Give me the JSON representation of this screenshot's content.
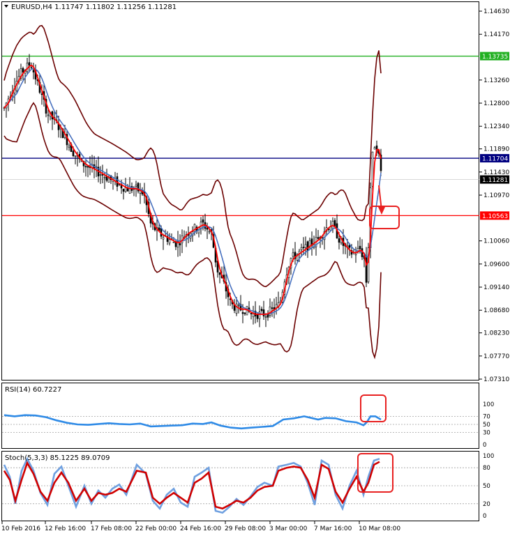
{
  "chart_data": [
    {
      "type": "candlestick",
      "title": "EURUSD,H4  1.11747 1.11802 1.11256 1.11281",
      "ylim": [
        1.0731,
        1.1463
      ],
      "yticks": [
        "1.14630",
        "1.14170",
        "1.13260",
        "1.12800",
        "1.12340",
        "1.11890",
        "1.11430",
        "1.10970",
        "1.10060",
        "1.09600",
        "1.09140",
        "1.08680",
        "1.08230",
        "1.07770",
        "1.07310"
      ],
      "x_tick_labels": [
        "10 Feb 2016",
        "12 Feb 16:00",
        "17 Feb 08:00",
        "22 Feb 00:00",
        "24 Feb 16:00",
        "29 Feb 08:00",
        "3 Mar 00:00",
        "7 Mar 16:00",
        "10 Mar 08:00"
      ],
      "horizontal_levels": [
        {
          "value": 1.13735,
          "label": "1.13735",
          "color": "#22b022"
        },
        {
          "value": 1.11704,
          "label": "1.11704",
          "color": "#000080"
        },
        {
          "value": 1.10563,
          "label": "1.10563",
          "color": "#ff0000"
        }
      ],
      "current_price": {
        "value": 1.11281,
        "label": "1.11281"
      },
      "price_path": [
        [
          0,
          1.127
        ],
        [
          12,
          1.131
        ],
        [
          24,
          1.134
        ],
        [
          38,
          1.136
        ],
        [
          50,
          1.131
        ],
        [
          62,
          1.126
        ],
        [
          75,
          1.124
        ],
        [
          88,
          1.121
        ],
        [
          100,
          1.118
        ],
        [
          112,
          1.116
        ],
        [
          125,
          1.115
        ],
        [
          138,
          1.114
        ],
        [
          150,
          1.113
        ],
        [
          162,
          1.112
        ],
        [
          175,
          1.111
        ],
        [
          188,
          1.111
        ],
        [
          200,
          1.11
        ],
        [
          210,
          1.104
        ],
        [
          222,
          1.102
        ],
        [
          235,
          1.101
        ],
        [
          248,
          1.1
        ],
        [
          260,
          1.102
        ],
        [
          272,
          1.103
        ],
        [
          285,
          1.104
        ],
        [
          297,
          1.102
        ],
        [
          305,
          1.095
        ],
        [
          315,
          1.092
        ],
        [
          325,
          1.088
        ],
        [
          335,
          1.087
        ],
        [
          345,
          1.087
        ],
        [
          355,
          1.086
        ],
        [
          365,
          1.086
        ],
        [
          375,
          1.086
        ],
        [
          385,
          1.087
        ],
        [
          395,
          1.088
        ],
        [
          402,
          1.093
        ],
        [
          410,
          1.097
        ],
        [
          420,
          1.098
        ],
        [
          430,
          1.099
        ],
        [
          440,
          1.1
        ],
        [
          450,
          1.101
        ],
        [
          460,
          1.103
        ],
        [
          470,
          1.104
        ],
        [
          480,
          1.101
        ],
        [
          490,
          1.099
        ],
        [
          500,
          1.098
        ],
        [
          510,
          1.099
        ],
        [
          516,
          1.097
        ],
        [
          520,
          1.091
        ],
        [
          523,
          1.104
        ],
        [
          526,
          1.115
        ],
        [
          530,
          1.12
        ],
        [
          534,
          1.119
        ],
        [
          538,
          1.117
        ],
        [
          541,
          1.113
        ]
      ],
      "ma_red_color": "#ff0000",
      "ma_blue_color": "#4472c4",
      "band_color": "#6b0000"
    },
    {
      "type": "line",
      "title": "RSI(14) 60.7227",
      "ylim": [
        0,
        100
      ],
      "yticks": [
        "100",
        "70",
        "50",
        "30",
        "0"
      ],
      "series": [
        {
          "values": [
            [
              0,
              73
            ],
            [
              15,
              70
            ],
            [
              30,
              73
            ],
            [
              45,
              72
            ],
            [
              60,
              68
            ],
            [
              75,
              60
            ],
            [
              90,
              54
            ],
            [
              105,
              50
            ],
            [
              120,
              49
            ],
            [
              135,
              51
            ],
            [
              150,
              53
            ],
            [
              165,
              51
            ],
            [
              180,
              50
            ],
            [
              195,
              52
            ],
            [
              210,
              45
            ],
            [
              225,
              46
            ],
            [
              240,
              47
            ],
            [
              255,
              48
            ],
            [
              270,
              52
            ],
            [
              285,
              51
            ],
            [
              297,
              55
            ],
            [
              310,
              47
            ],
            [
              325,
              42
            ],
            [
              340,
              40
            ],
            [
              355,
              42
            ],
            [
              370,
              44
            ],
            [
              385,
              46
            ],
            [
              400,
              62
            ],
            [
              415,
              65
            ],
            [
              430,
              70
            ],
            [
              440,
              66
            ],
            [
              450,
              62
            ],
            [
              460,
              66
            ],
            [
              475,
              65
            ],
            [
              490,
              58
            ],
            [
              505,
              55
            ],
            [
              515,
              48
            ],
            [
              520,
              56
            ],
            [
              525,
              70
            ],
            [
              532,
              70
            ],
            [
              540,
              62
            ]
          ],
          "color": "#2e8ae6"
        }
      ]
    },
    {
      "type": "line",
      "title": "Stoch(5,3,3) 85.1225 89.0709",
      "ylim": [
        0,
        100
      ],
      "yticks": [
        "100",
        "80",
        "50",
        "20",
        "0"
      ],
      "series": [
        {
          "values": [
            [
              0,
              75
            ],
            [
              8,
              60
            ],
            [
              16,
              25
            ],
            [
              25,
              60
            ],
            [
              33,
              88
            ],
            [
              42,
              70
            ],
            [
              52,
              40
            ],
            [
              62,
              25
            ],
            [
              72,
              55
            ],
            [
              82,
              72
            ],
            [
              92,
              55
            ],
            [
              103,
              25
            ],
            [
              115,
              45
            ],
            [
              125,
              25
            ],
            [
              135,
              38
            ],
            [
              145,
              35
            ],
            [
              155,
              38
            ],
            [
              165,
              45
            ],
            [
              175,
              40
            ],
            [
              190,
              75
            ],
            [
              203,
              72
            ],
            [
              213,
              30
            ],
            [
              223,
              20
            ],
            [
              233,
              30
            ],
            [
              243,
              38
            ],
            [
              253,
              30
            ],
            [
              263,
              22
            ],
            [
              273,
              55
            ],
            [
              283,
              62
            ],
            [
              293,
              72
            ],
            [
              303,
              15
            ],
            [
              313,
              12
            ],
            [
              323,
              18
            ],
            [
              333,
              25
            ],
            [
              343,
              22
            ],
            [
              353,
              30
            ],
            [
              363,
              42
            ],
            [
              373,
              48
            ],
            [
              385,
              50
            ],
            [
              393,
              75
            ],
            [
              405,
              80
            ],
            [
              415,
              82
            ],
            [
              425,
              80
            ],
            [
              435,
              60
            ],
            [
              445,
              30
            ],
            [
              455,
              85
            ],
            [
              465,
              78
            ],
            [
              475,
              40
            ],
            [
              485,
              22
            ],
            [
              495,
              45
            ],
            [
              505,
              65
            ],
            [
              515,
              40
            ],
            [
              522,
              55
            ],
            [
              530,
              85
            ],
            [
              538,
              90
            ]
          ],
          "color": "#d00000"
        },
        {
          "values": [
            [
              0,
              85
            ],
            [
              8,
              65
            ],
            [
              16,
              20
            ],
            [
              25,
              75
            ],
            [
              33,
              95
            ],
            [
              42,
              75
            ],
            [
              52,
              38
            ],
            [
              62,
              18
            ],
            [
              72,
              70
            ],
            [
              82,
              82
            ],
            [
              92,
              50
            ],
            [
              103,
              15
            ],
            [
              115,
              50
            ],
            [
              125,
              20
            ],
            [
              135,
              42
            ],
            [
              145,
              30
            ],
            [
              155,
              45
            ],
            [
              165,
              52
            ],
            [
              175,
              35
            ],
            [
              190,
              85
            ],
            [
              203,
              70
            ],
            [
              213,
              25
            ],
            [
              223,
              12
            ],
            [
              233,
              35
            ],
            [
              243,
              45
            ],
            [
              253,
              22
            ],
            [
              263,
              15
            ],
            [
              273,
              65
            ],
            [
              283,
              72
            ],
            [
              293,
              80
            ],
            [
              303,
              8
            ],
            [
              313,
              5
            ],
            [
              323,
              15
            ],
            [
              333,
              28
            ],
            [
              343,
              18
            ],
            [
              353,
              32
            ],
            [
              363,
              48
            ],
            [
              373,
              55
            ],
            [
              385,
              50
            ],
            [
              393,
              82
            ],
            [
              405,
              85
            ],
            [
              415,
              88
            ],
            [
              425,
              82
            ],
            [
              435,
              55
            ],
            [
              445,
              18
            ],
            [
              455,
              92
            ],
            [
              465,
              85
            ],
            [
              475,
              35
            ],
            [
              485,
              12
            ],
            [
              495,
              50
            ],
            [
              505,
              75
            ],
            [
              515,
              35
            ],
            [
              522,
              65
            ],
            [
              530,
              92
            ],
            [
              538,
              95
            ]
          ],
          "color": "#6fa0e0"
        }
      ]
    }
  ]
}
